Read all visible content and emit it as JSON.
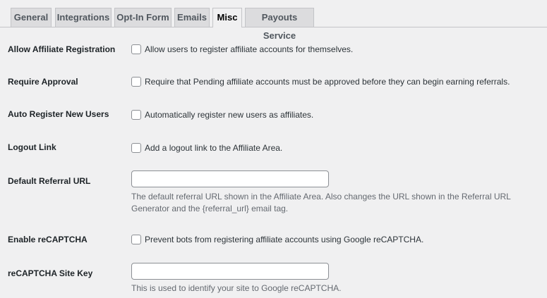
{
  "tabs": [
    {
      "label": "General"
    },
    {
      "label": "Integrations"
    },
    {
      "label": "Opt-In Form"
    },
    {
      "label": "Emails"
    },
    {
      "label": "Misc",
      "active": true
    },
    {
      "label": "Payouts Service"
    }
  ],
  "settings": {
    "allow_registration": {
      "label": "Allow Affiliate Registration",
      "checkbox_label": "Allow users to register affiliate accounts for themselves.",
      "checked": false
    },
    "require_approval": {
      "label": "Require Approval",
      "checkbox_label": "Require that Pending affiliate accounts must be approved before they can begin earning referrals.",
      "checked": false
    },
    "auto_register": {
      "label": "Auto Register New Users",
      "checkbox_label": "Automatically register new users as affiliates.",
      "checked": false
    },
    "logout_link": {
      "label": "Logout Link",
      "checkbox_label": "Add a logout link to the Affiliate Area.",
      "checked": false
    },
    "default_referral_url": {
      "label": "Default Referral URL",
      "value": "",
      "description": "The default referral URL shown in the Affiliate Area. Also changes the URL shown in the Referral URL Generator and the {referral_url} email tag."
    },
    "enable_recaptcha": {
      "label": "Enable reCAPTCHA",
      "checkbox_label": "Prevent bots from registering affiliate accounts using Google reCAPTCHA.",
      "checked": false
    },
    "recaptcha_site_key": {
      "label": "reCAPTCHA Site Key",
      "value": "",
      "description": "This is used to identify your site to Google reCAPTCHA."
    }
  }
}
